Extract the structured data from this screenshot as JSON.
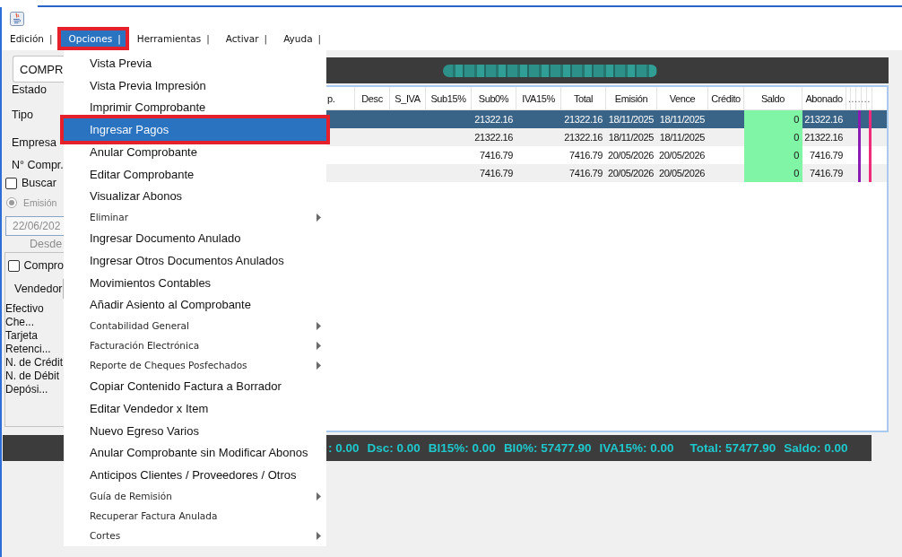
{
  "menu_bar": [
    {
      "label": "Edición",
      "separator": "|",
      "selected": false
    },
    {
      "label": "Opciones",
      "separator": "|",
      "selected": true
    },
    {
      "label": "Herramientas",
      "separator": "|",
      "selected": false
    },
    {
      "label": "Activar",
      "separator": "|",
      "selected": false
    },
    {
      "label": "Ayuda",
      "separator": "|",
      "selected": false
    }
  ],
  "left_panel": {
    "document_type": {
      "value": "COMPR"
    },
    "labels": [
      "Estado",
      "Tipo",
      "Empresa",
      "N° Compr."
    ],
    "search_checkbox": {
      "label": "Buscar",
      "checked": false
    },
    "date_filter": {
      "option": {
        "label": "Emisión",
        "selected": true,
        "disabled": true
      },
      "date_field": {
        "value": "22/06/202",
        "disabled": true
      },
      "caption": "Desde"
    },
    "filter_group": {
      "checkbox": {
        "label": "Compro",
        "checked": false
      },
      "vendor_label": "Vendedor",
      "payment_types": [
        "Efectivo",
        "Che...",
        "Tarjeta",
        "Retenci...",
        "N. de Crédit",
        "N. de Débit",
        "Depósi..."
      ]
    }
  },
  "table": {
    "columns": [
      "p.",
      "Desc",
      "S_IVA",
      "Sub15%",
      "Sub0%",
      "IVA15%",
      "Total",
      "Emisión",
      "Vence",
      "Crédito",
      "Saldo",
      "Abonado"
    ],
    "marker_header": ".......",
    "rows": [
      {
        "selected": true,
        "settled": true,
        "cells": [
          null,
          null,
          null,
          null,
          "21322.16",
          null,
          "21322.16",
          "18/11/2025",
          "18/11/2025",
          null,
          "0",
          "21322.16"
        ],
        "markers": [
          {
            "color": "#8c1bb3"
          },
          {
            "color": "#f02b7c"
          }
        ]
      },
      {
        "selected": false,
        "settled": true,
        "cells": [
          null,
          null,
          null,
          null,
          "21322.16",
          null,
          "21322.16",
          "18/11/2025",
          "18/11/2025",
          null,
          "0",
          "21322.16"
        ],
        "markers": [
          {
            "color": "#8c1bb3"
          },
          {
            "color": "#f02b7c"
          }
        ]
      },
      {
        "selected": false,
        "settled": true,
        "cells": [
          null,
          null,
          null,
          null,
          "7416.79",
          null,
          "7416.79",
          "20/05/2026",
          "20/05/2026",
          null,
          "0",
          "7416.79"
        ],
        "markers": [
          {
            "color": "#8c1bb3"
          },
          {
            "color": "#f02b7c"
          }
        ]
      },
      {
        "selected": false,
        "settled": true,
        "cells": [
          null,
          null,
          null,
          null,
          "7416.79",
          null,
          "7416.79",
          "20/05/2026",
          "20/05/2026",
          null,
          "0",
          "7416.79"
        ],
        "markers": [
          {
            "color": "#8c1bb3"
          },
          {
            "color": "#f02b7c"
          }
        ]
      }
    ]
  },
  "totals_bar": {
    "breakdown": [
      ": 0.00",
      "Dsc: 0.00",
      "BI15%: 0.00",
      "BI0%: 57477.90",
      "IVA15%: 0.00"
    ],
    "totals": [
      "Total: 57477.90",
      "Saldo: 0.00"
    ]
  },
  "context_menu": {
    "items": [
      {
        "label": "Vista Previa",
        "kind": "standard",
        "submenu": false,
        "selected": false
      },
      {
        "label": "Vista Previa Impresión",
        "kind": "standard",
        "submenu": false,
        "selected": false
      },
      {
        "label": "Imprimir Comprobante",
        "kind": "standard",
        "submenu": false,
        "selected": false
      },
      {
        "label": "Ingresar Pagos",
        "kind": "standard",
        "submenu": false,
        "selected": true
      },
      {
        "label": "Anular Comprobante",
        "kind": "standard",
        "submenu": false,
        "selected": false
      },
      {
        "label": "Editar Comprobante",
        "kind": "standard",
        "submenu": false,
        "selected": false
      },
      {
        "label": "Visualizar Abonos",
        "kind": "standard",
        "submenu": false,
        "selected": false
      },
      {
        "label": "Eliminar",
        "kind": "compact",
        "submenu": true,
        "selected": false
      },
      {
        "label": "Ingresar Documento Anulado",
        "kind": "standard",
        "submenu": false,
        "selected": false
      },
      {
        "label": "Ingresar Otros Documentos Anulados",
        "kind": "standard",
        "submenu": false,
        "selected": false
      },
      {
        "label": "Movimientos Contables",
        "kind": "standard",
        "submenu": false,
        "selected": false
      },
      {
        "label": "Añadir Asiento al Comprobante",
        "kind": "standard",
        "submenu": false,
        "selected": false
      },
      {
        "label": "Contabilidad General",
        "kind": "compact",
        "submenu": true,
        "selected": false
      },
      {
        "label": "Facturación Electrónica",
        "kind": "compact",
        "submenu": true,
        "selected": false
      },
      {
        "label": "Reporte de Cheques Posfechados",
        "kind": "compact",
        "submenu": true,
        "selected": false
      },
      {
        "label": "Copiar Contenido Factura a Borrador",
        "kind": "standard",
        "submenu": false,
        "selected": false
      },
      {
        "label": "Editar Vendedor x Item",
        "kind": "standard",
        "submenu": false,
        "selected": false
      },
      {
        "label": "Nuevo Egreso Varios",
        "kind": "standard",
        "submenu": false,
        "selected": false
      },
      {
        "label": "Anular Comprobante sin Modificar Abonos",
        "kind": "standard",
        "submenu": false,
        "selected": false
      },
      {
        "label": "Anticipos Clientes / Proveedores / Otros",
        "kind": "standard",
        "submenu": false,
        "selected": false
      },
      {
        "label": "Guía de Remisión",
        "kind": "compact",
        "submenu": true,
        "selected": false
      },
      {
        "label": "Recuperar Factura Anulada",
        "kind": "compact",
        "submenu": false,
        "selected": false
      },
      {
        "label": "Cortes",
        "kind": "compact",
        "submenu": true,
        "selected": false
      }
    ]
  }
}
